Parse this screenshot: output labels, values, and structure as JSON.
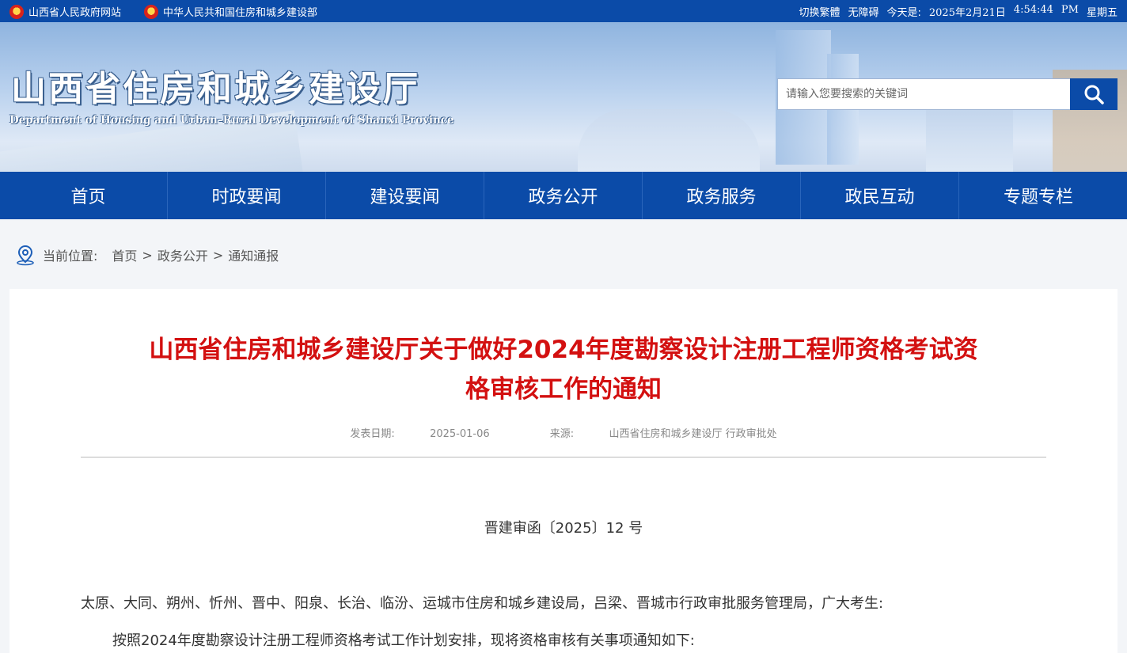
{
  "topbar": {
    "link1": "山西省人民政府网站",
    "link2": "中华人民共和国住房和城乡建设部",
    "switch_trad": "切换繁體",
    "accessibility": "无障碍",
    "today_label": "今天是:",
    "date": "2025年2月21日",
    "time": "4:54:44",
    "ampm": "PM",
    "weekday": "星期五"
  },
  "banner": {
    "title": "山西省住房和城乡建设厅",
    "subtitle": "Department of Housing and Urban–Rural Development of Shanxi Province",
    "search_placeholder": "请输入您要搜索的关键词"
  },
  "nav": [
    "首页",
    "时政要闻",
    "建设要闻",
    "政务公开",
    "政务服务",
    "政民互动",
    "专题专栏"
  ],
  "breadcrumb": {
    "label": "当前位置:",
    "items": [
      "首页",
      "政务公开",
      "通知通报"
    ],
    "separator": ">"
  },
  "article": {
    "title_line1": "山西省住房和城乡建设厅关于做好2024年度勘察设计注册工程师资格考试资",
    "title_line2": "格审核工作的通知",
    "date_label": "发表日期:",
    "date": "2025-01-06",
    "source_label": "来源:",
    "source": "山西省住房和城乡建设厅 行政审批处",
    "doc_number": "晋建审函〔2025〕12 号",
    "addressees": "太原、大同、朔州、忻州、晋中、阳泉、长治、临汾、运城市住房和城乡建设局，吕梁、晋城市行政审批服务管理局，广大考生:",
    "para1": "按照2024年度勘察设计注册工程师资格考试工作计划安排，现将资格审核有关事项通知如下:"
  },
  "colors": {
    "brand_blue": "#0b4ba8",
    "title_red": "#d31010"
  }
}
